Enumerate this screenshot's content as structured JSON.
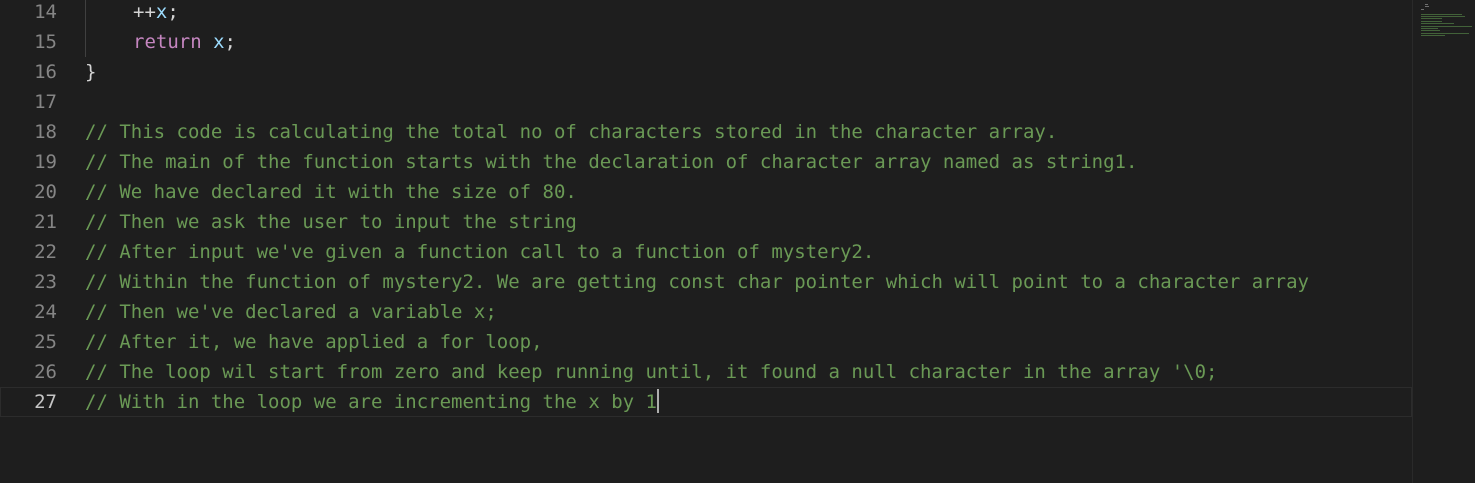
{
  "editor": {
    "lines": [
      {
        "number": "14",
        "indent": 1,
        "tokens": [
          {
            "t": "++",
            "c": "op"
          },
          {
            "t": "x",
            "c": "var"
          },
          {
            "t": ";",
            "c": "punc"
          }
        ]
      },
      {
        "number": "15",
        "indent": 1,
        "tokens": [
          {
            "t": "return",
            "c": "kw"
          },
          {
            "t": " ",
            "c": "op"
          },
          {
            "t": "x",
            "c": "var"
          },
          {
            "t": ";",
            "c": "punc"
          }
        ]
      },
      {
        "number": "16",
        "indent": 0,
        "tokens": [
          {
            "t": "}",
            "c": "brace"
          }
        ]
      },
      {
        "number": "17",
        "indent": 0,
        "tokens": []
      },
      {
        "number": "18",
        "indent": 0,
        "tokens": [
          {
            "t": "// This code is calculating the total no of characters stored in the character array.",
            "c": "comment"
          }
        ]
      },
      {
        "number": "19",
        "indent": 0,
        "tokens": [
          {
            "t": "// The main of the function starts with the declaration of character array named as string1.",
            "c": "comment"
          }
        ]
      },
      {
        "number": "20",
        "indent": 0,
        "tokens": [
          {
            "t": "// We have declared it with the size of 80.",
            "c": "comment"
          }
        ]
      },
      {
        "number": "21",
        "indent": 0,
        "tokens": [
          {
            "t": "// Then we ask the user to input the string",
            "c": "comment"
          }
        ]
      },
      {
        "number": "22",
        "indent": 0,
        "tokens": [
          {
            "t": "// After input we've given a function call to a function of mystery2.",
            "c": "comment"
          }
        ]
      },
      {
        "number": "23",
        "indent": 0,
        "tokens": [
          {
            "t": "// Within the function of mystery2. We are getting const char pointer which will point to a character array",
            "c": "comment"
          }
        ]
      },
      {
        "number": "24",
        "indent": 0,
        "tokens": [
          {
            "t": "// Then we've declared a variable x;",
            "c": "comment"
          }
        ]
      },
      {
        "number": "25",
        "indent": 0,
        "tokens": [
          {
            "t": "// After it, we have applied a for loop,",
            "c": "comment"
          }
        ]
      },
      {
        "number": "26",
        "indent": 0,
        "tokens": [
          {
            "t": "// The loop wil start from zero and keep running until, it found a null character in the array '\\0;",
            "c": "comment"
          }
        ]
      },
      {
        "number": "27",
        "indent": 0,
        "current": true,
        "tokens": [
          {
            "t": "// With in the loop we are incrementing the x by 1",
            "c": "comment"
          }
        ]
      }
    ]
  },
  "colors": {
    "background": "#1e1e1e",
    "comment": "#6a9955",
    "keyword": "#c586c0",
    "variable": "#9cdcfe",
    "line_number": "#858585",
    "line_number_active": "#c6c6c6"
  }
}
